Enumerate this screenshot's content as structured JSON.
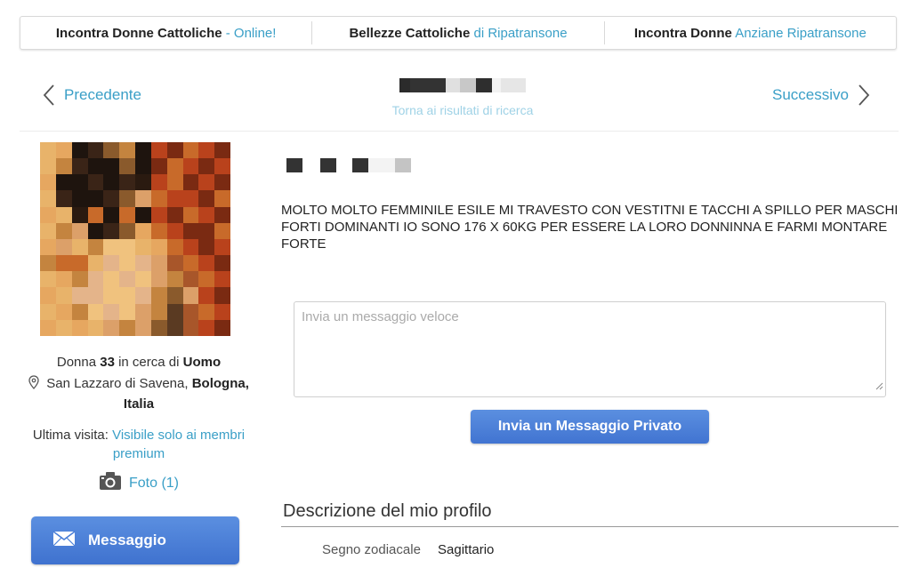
{
  "topbar": {
    "links": [
      {
        "bold": "Incontra Donne Cattoliche",
        "accent": " - Online!"
      },
      {
        "bold": "Bellezze Cattoliche",
        "accent": " di Ripatransone"
      },
      {
        "bold": "Incontra Donne",
        "accent": " Anziane Ripatransone"
      }
    ]
  },
  "nav": {
    "prev_label": "Precedente",
    "next_label": "Successivo",
    "back_link": "Torna ai risultati di ricerca"
  },
  "profile": {
    "gender": "Donna",
    "age": "33",
    "seeking_prefix": "in cerca di",
    "seeking": "Uomo",
    "city": "San Lazzaro di Savena,",
    "province": "Bologna,",
    "country": "Italia",
    "last_visit_label": "Ultima visita:",
    "last_visit_value": "Visibile solo ai membri premium",
    "photos_label": "Foto (1)",
    "message_button": "Messaggio",
    "bio": "MOLTO MOLTO FEMMINILE ESILE MI TRAVESTO CON VESTITNI E TACCHI A SPILLO PER MASCHI FORTI DOMINANTI IO SONO 176 X 60KG PER ESSERE LA LORO DONNINNA E FARMI MONTARE FORTE"
  },
  "quick_message": {
    "placeholder": "Invia un messaggio veloce",
    "send_button": "Invia un Messaggio Privato"
  },
  "description": {
    "title": "Descrizione del mio profilo",
    "zodiac_label": "Segno zodiacale",
    "zodiac_value": "Sagittario"
  },
  "colors": {
    "accent": "#3a9fc7",
    "button_blue": "#4a7fd8"
  },
  "icons": [
    "chevron-left-icon",
    "chevron-right-icon",
    "location-pin-icon",
    "camera-icon",
    "envelope-icon",
    "resize-handle-icon"
  ]
}
